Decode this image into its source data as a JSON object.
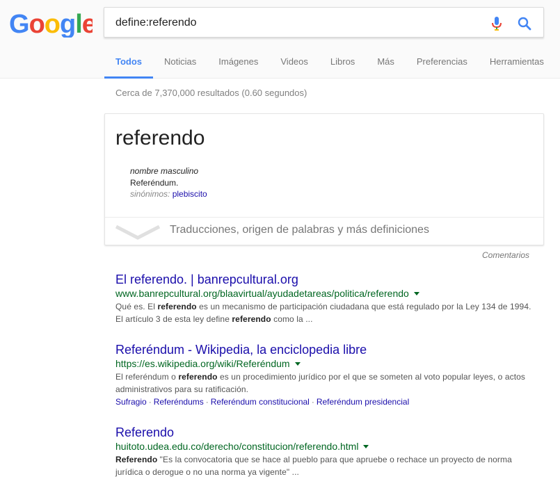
{
  "search": {
    "query": "define:referendo"
  },
  "tabs": [
    "Todos",
    "Noticias",
    "Imágenes",
    "Videos",
    "Libros",
    "Más",
    "Preferencias",
    "Herramientas"
  ],
  "stats": "Cerca de 7,370,000 resultados (0.60 segundos)",
  "dictionary": {
    "word": "referendo",
    "pos": "nombre masculino",
    "definition": "Referéndum.",
    "synonyms_label": "sinónimos:",
    "synonym": "plebiscito",
    "more": "Traducciones, origen de palabras y más definiciones"
  },
  "feedback": "Comentarios",
  "results": [
    {
      "title": "El referendo. | banrepcultural.org",
      "url": "www.banrepcultural.org/blaavirtual/ayudadetareas/politica/referendo",
      "snippet_parts": [
        {
          "t": "Qué es. El "
        },
        {
          "t": "referendo",
          "b": true
        },
        {
          "t": " es un mecanismo de participación ciudadana que está regulado por la Ley 134 de 1994. El artículo 3 de esta ley define "
        },
        {
          "t": "referendo",
          "b": true
        },
        {
          "t": " como la ..."
        }
      ]
    },
    {
      "title": "Referéndum - Wikipedia, la enciclopedia libre",
      "url": "https://es.wikipedia.org/wiki/Referéndum",
      "snippet_parts": [
        {
          "t": "El referéndum o "
        },
        {
          "t": "referendo",
          "b": true
        },
        {
          "t": " es un procedimiento jurídico por el que se someten al voto popular leyes, o actos administrativos para su ratificación."
        }
      ],
      "sitelinks": [
        "Sufragio",
        "Referéndums",
        "Referéndum constitucional",
        "Referéndum presidencial"
      ]
    },
    {
      "title": "Referendo",
      "url": "huitoto.udea.edu.co/derecho/constitucion/referendo.html",
      "snippet_parts": [
        {
          "t": "Referendo",
          "b": true
        },
        {
          "t": " \"Es la convocatoria que se hace al pueblo para que apruebe o rechace un proyecto de norma jurídica o derogue o no una norma ya vigente\" ..."
        }
      ]
    }
  ],
  "colors": {
    "link": "#1a0dab",
    "url": "#006621",
    "active_tab": "#4285f4"
  },
  "icons": [
    "google-logo",
    "microphone-icon",
    "search-icon",
    "chevron-down-icon",
    "dropdown-caret-icon"
  ]
}
